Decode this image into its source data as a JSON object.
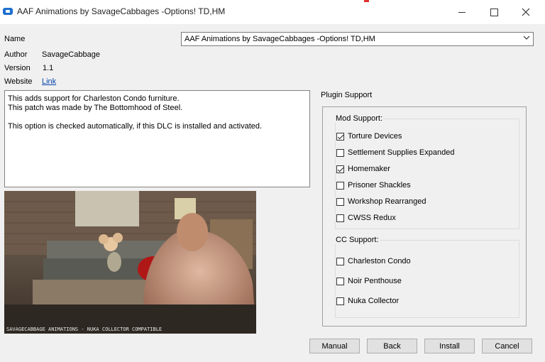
{
  "window": {
    "title": "AAF Animations by SavageCabbages -Options! TD,HM",
    "controls": {
      "minimize": "minimize-icon",
      "maximize": "maximize-icon",
      "close": "close-icon"
    }
  },
  "info": {
    "name_label": "Name",
    "author_label": "Author",
    "author": "SavageCabbage",
    "version_label": "Version",
    "version": "1.1",
    "website_label": "Website",
    "website_link": "Link"
  },
  "option_select": {
    "selected": "AAF Animations by SavageCabbages -Options! TD,HM"
  },
  "description": {
    "line1": "This adds support for Charleston Condo furniture.",
    "line2": "This patch was made by The Bottomhood of Steel.",
    "line3": "This option is checked automatically, if this DLC is installed and activated."
  },
  "preview": {
    "caption": "SAVAGECABBAGE ANIMATIONS - NUKA COLLECTOR COMPATIBLE"
  },
  "plugin_support": {
    "title": "Plugin Support",
    "mod_support": {
      "title": "Mod Support:",
      "items": [
        {
          "label": "Torture Devices",
          "checked": true
        },
        {
          "label": "Settlement Supplies Expanded",
          "checked": false
        },
        {
          "label": "Homemaker",
          "checked": true
        },
        {
          "label": "Prisoner Shackles",
          "checked": false
        },
        {
          "label": "Workshop Rearranged",
          "checked": false
        },
        {
          "label": "CWSS Redux",
          "checked": false
        }
      ]
    },
    "cc_support": {
      "title": "CC Support:",
      "items": [
        {
          "label": "Charleston Condo",
          "checked": false
        },
        {
          "label": "Noir Penthouse",
          "checked": false
        },
        {
          "label": "Nuka Collector",
          "checked": false
        }
      ]
    }
  },
  "buttons": {
    "manual": "Manual",
    "back": "Back",
    "install": "Install",
    "cancel": "Cancel"
  },
  "colors": {
    "link": "#0645ad",
    "window_bg": "#f0f0f0",
    "app_icon": "#1e6fd0"
  }
}
